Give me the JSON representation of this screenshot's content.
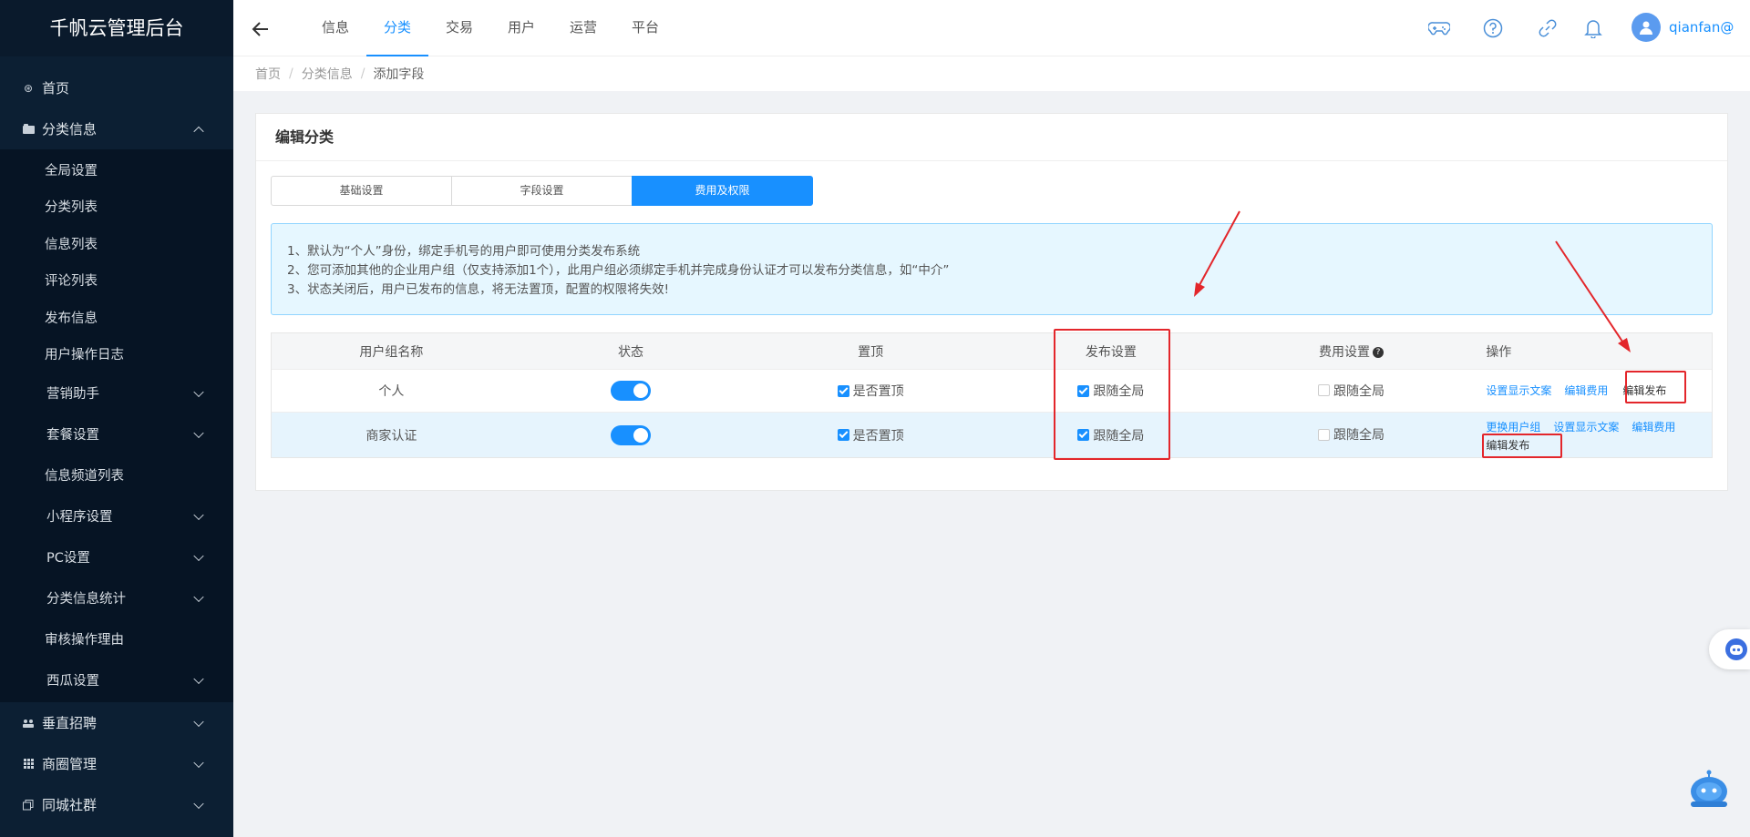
{
  "app": {
    "title": "千帆云管理后台"
  },
  "sidebar": {
    "home": "首页",
    "classified": "分类信息",
    "sub_items": [
      "全局设置",
      "分类列表",
      "信息列表",
      "评论列表",
      "发布信息",
      "用户操作日志"
    ],
    "sub_groups_a": [
      "营销助手",
      "套餐设置"
    ],
    "sub_items_b": [
      "信息频道列表"
    ],
    "sub_groups_b": [
      "小程序设置",
      "PC设置",
      "分类信息统计"
    ],
    "sub_items_c": [
      "审核操作理由"
    ],
    "sub_groups_c": [
      "西瓜设置"
    ],
    "bottom": [
      "垂直招聘",
      "商圈管理",
      "同城社群"
    ]
  },
  "header": {
    "tabs": [
      "信息",
      "分类",
      "交易",
      "用户",
      "运营",
      "平台"
    ],
    "active_tab": "分类",
    "user": "qianfan@"
  },
  "breadcrumb": [
    "首页",
    "分类信息",
    "添加字段"
  ],
  "card": {
    "title": "编辑分类",
    "segments": [
      "基础设置",
      "字段设置",
      "费用及权限"
    ],
    "active_segment": "费用及权限",
    "notice": [
      "1、默认为“个人”身份，绑定手机号的用户即可使用分类发布系统",
      "2、您可添加其他的企业用户组（仅支持添加1个），此用户组必须绑定手机并完成身份认证才可以发布分类信息，如“中介”",
      "3、状态关闭后，用户已发布的信息，将无法置顶，配置的权限将失效!"
    ]
  },
  "table": {
    "headers": [
      "用户组名称",
      "状态",
      "置顶",
      "发布设置",
      "费用设置",
      "操作"
    ],
    "help_mark": "?",
    "rows": [
      {
        "name": "个人",
        "status_on": true,
        "top_label": "是否置顶",
        "top_checked": true,
        "publish_label": "跟随全局",
        "publish_checked": true,
        "fee_label": "跟随全局",
        "fee_checked": false,
        "ops": [
          "设置显示文案",
          "编辑费用",
          "编辑发布"
        ]
      },
      {
        "name": "商家认证",
        "status_on": true,
        "top_label": "是否置顶",
        "top_checked": true,
        "publish_label": "跟随全局",
        "publish_checked": true,
        "fee_label": "跟随全局",
        "fee_checked": false,
        "ops": [
          "更换用户组",
          "设置显示文案",
          "编辑费用",
          "编辑发布"
        ]
      }
    ]
  },
  "colors": {
    "primary": "#1890ff",
    "sidebar_bg": "#0c1f33",
    "annotation_red": "#e3262b",
    "notice_bg": "#e6f7ff"
  },
  "icons": [
    "back-arrow-icon",
    "gamepad-icon",
    "help-circle-icon",
    "link-icon",
    "bell-icon",
    "user-icon",
    "robot-icon"
  ]
}
